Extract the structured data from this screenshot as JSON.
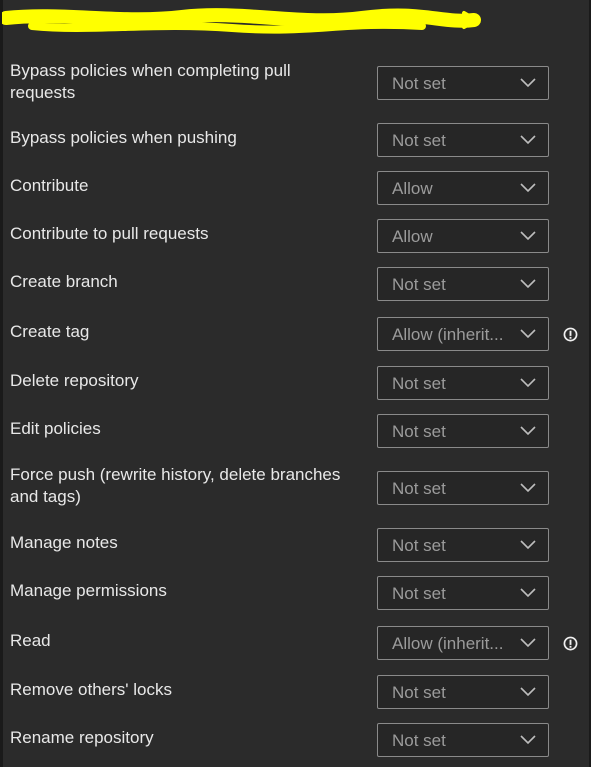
{
  "permissions": [
    {
      "label": "Bypass policies when completing pull requests",
      "value": "Not set",
      "info": false
    },
    {
      "label": "Bypass policies when pushing",
      "value": "Not set",
      "info": false
    },
    {
      "label": "Contribute",
      "value": "Allow",
      "info": false
    },
    {
      "label": "Contribute to pull requests",
      "value": "Allow",
      "info": false
    },
    {
      "label": "Create branch",
      "value": "Not set",
      "info": false
    },
    {
      "label": "Create tag",
      "value": "Allow (inherit...",
      "info": true
    },
    {
      "label": "Delete repository",
      "value": "Not set",
      "info": false
    },
    {
      "label": "Edit policies",
      "value": "Not set",
      "info": false
    },
    {
      "label": "Force push (rewrite history, delete branches and tags)",
      "value": "Not set",
      "info": false
    },
    {
      "label": "Manage notes",
      "value": "Not set",
      "info": false
    },
    {
      "label": "Manage permissions",
      "value": "Not set",
      "info": false
    },
    {
      "label": "Read",
      "value": "Allow (inherit...",
      "info": true
    },
    {
      "label": "Remove others' locks",
      "value": "Not set",
      "info": false
    },
    {
      "label": "Rename repository",
      "value": "Not set",
      "info": false
    }
  ],
  "icons": {
    "dropdown": "chevron-down-icon",
    "info": "info-icon"
  },
  "colors": {
    "background": "#2b2b2b",
    "redaction_highlight": "#ffff00"
  }
}
